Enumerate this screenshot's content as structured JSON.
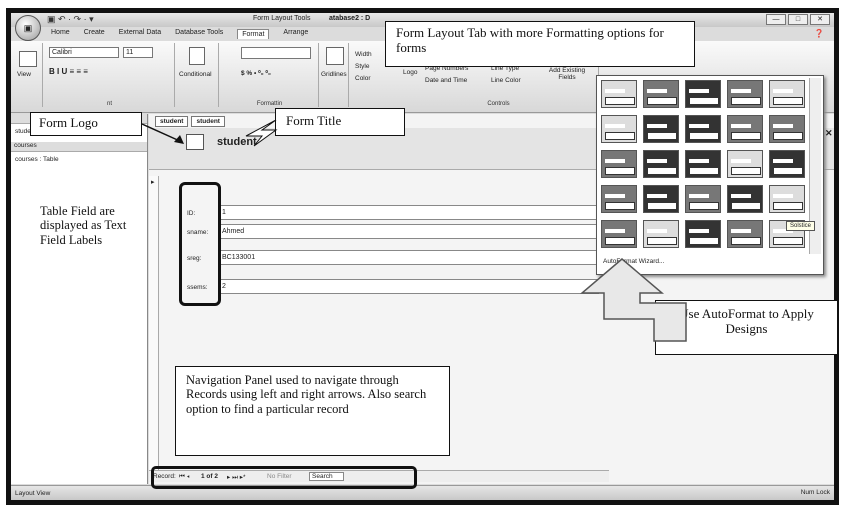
{
  "titlebar": {
    "qat": "▣ ↶ · ↷ · ▾",
    "context_tools": "Form Layout Tools",
    "db_title": "atabase2 : D",
    "win": [
      "—",
      "□",
      "✕"
    ]
  },
  "tabs": [
    "Home",
    "Create",
    "External Data",
    "Database Tools",
    "Format",
    "Arrange"
  ],
  "ribbon": {
    "view_label": "View",
    "font_name": "Calibri",
    "font_size": "11",
    "font_group_label": "nt",
    "conditional_label": "Conditional",
    "number_fmt": "$ % • ⁰₀ ⁰₀",
    "formatting_label": "Formattin",
    "gridlines_label": "Gridlines",
    "width_label": "Width",
    "style_label": "Style",
    "color_label": "Color",
    "logo_label": "Logo",
    "page_numbers": "Page Numbers",
    "line_type": "Line Type",
    "date_time": "Date and Time",
    "line_color": "Line Color",
    "add_existing": "Add Existing Fields",
    "controls_label": "Controls"
  },
  "nav": {
    "item1": "student : Table",
    "group2": "courses",
    "item2": "courses : Table"
  },
  "form": {
    "doc_tabs": [
      "student",
      "student"
    ],
    "title": "student",
    "fields": [
      {
        "label": "ID:",
        "value": "1"
      },
      {
        "label": "sname:",
        "value": "Ahmed"
      },
      {
        "label": "sreg:",
        "value": "BC133001"
      },
      {
        "label": "ssems:",
        "value": "2"
      }
    ]
  },
  "navbar": {
    "record": "Record:",
    "first_prev": "⏮ ◂",
    "position": "1 of 2",
    "next_last": "▸ ⏭ ▸*",
    "nofilter": "No Filter",
    "search": "Search"
  },
  "gallery": {
    "autoformat_wizard": "AutoFormat Wizard...",
    "tooltip": "Solstice"
  },
  "status": {
    "view": "Layout View",
    "numlock": "Num Lock"
  },
  "callouts": {
    "format_tab": "Form Layout Tab with more Formatting options for forms",
    "form_logo": "Form Logo",
    "form_title": "Form Title",
    "table_fields": "Table Field are displayed as Text Field Labels",
    "autoformat": "Use AutoFormat to Apply Designs",
    "navigation": "Navigation Panel used to navigate through Records using left and right arrows. Also search option to find a particular record"
  }
}
